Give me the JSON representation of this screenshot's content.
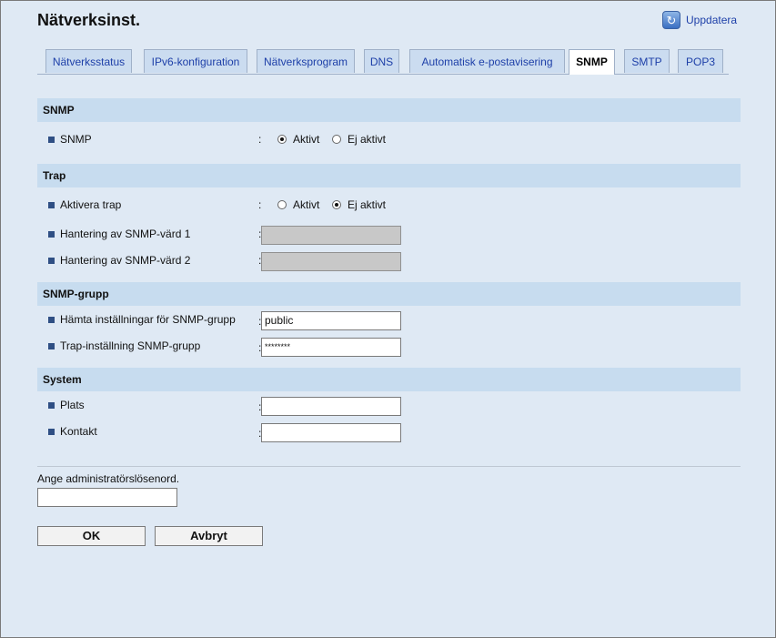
{
  "header": {
    "title": "Nätverksinst.",
    "refresh_label": "Uppdatera",
    "refresh_icon": "refresh-icon"
  },
  "tabs": [
    {
      "label": "Nätverksstatus",
      "active": false
    },
    {
      "label": "IPv6-konfiguration",
      "active": false
    },
    {
      "label": "Nätverksprogram",
      "active": false
    },
    {
      "label": "DNS",
      "active": false
    },
    {
      "label": "Automatisk e-postavisering",
      "active": false
    },
    {
      "label": "SNMP",
      "active": true
    },
    {
      "label": "SMTP",
      "active": false
    },
    {
      "label": "POP3",
      "active": false
    }
  ],
  "sections": {
    "snmp": {
      "title": "SNMP",
      "snmp_label": "SNMP",
      "colon": ":",
      "options": [
        "Aktivt",
        "Ej aktivt"
      ],
      "selected": "Aktivt"
    },
    "trap": {
      "title": "Trap",
      "enable_label": "Aktivera trap",
      "colon": ":",
      "options": [
        "Aktivt",
        "Ej aktivt"
      ],
      "selected": "Ej aktivt",
      "host1_label": "Hantering av SNMP-värd 1",
      "host1_value": "",
      "host2_label": "Hantering av SNMP-värd 2",
      "host2_value": ""
    },
    "group": {
      "title": "SNMP-grupp",
      "get_label": "Hämta inställningar för SNMP-grupp",
      "get_value": "public",
      "trap_label": "Trap-inställning SNMP-grupp",
      "trap_value": "********"
    },
    "system": {
      "title": "System",
      "location_label": "Plats",
      "location_value": "",
      "contact_label": "Kontakt",
      "contact_value": ""
    }
  },
  "admin": {
    "label": "Ange administratörslösenord.",
    "value": ""
  },
  "buttons": {
    "ok": "OK",
    "cancel": "Avbryt"
  },
  "colors": {
    "background": "#dfe9f4",
    "section_header": "#c7dcef",
    "tab": "#cbdcf0",
    "link": "#1d3fa8"
  }
}
